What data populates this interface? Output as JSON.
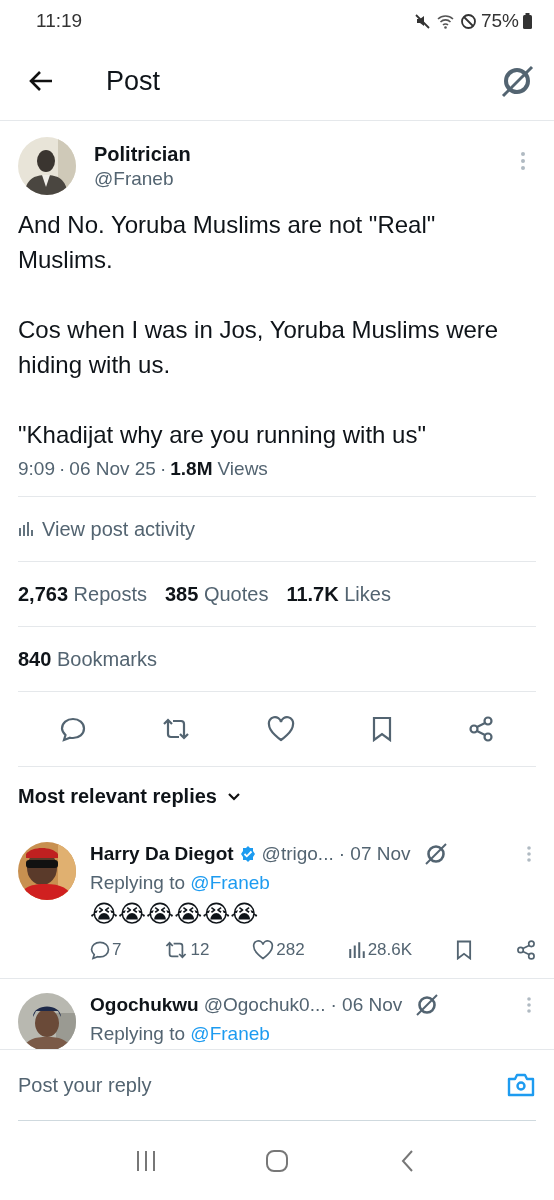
{
  "status_bar": {
    "time": "11:19",
    "battery": "75%"
  },
  "header": {
    "title": "Post"
  },
  "post": {
    "author": {
      "name": "Politrician",
      "handle": "@Franeb"
    },
    "paragraphs": [
      "And No. Yoruba Muslims are not \"Real\" Muslims.",
      "Cos when I was in Jos, Yoruba Muslims were hiding with us.",
      "\"Khadijat why are you running with us\""
    ],
    "time": "9:09",
    "separator": "·",
    "date": "06 Nov 25",
    "views_count": "1.8M",
    "views_label": "Views",
    "activity_link": "View post activity",
    "stats": [
      {
        "count": "2,763",
        "label": "Reposts"
      },
      {
        "count": "385",
        "label": "Quotes"
      },
      {
        "count": "11.7K",
        "label": "Likes"
      }
    ],
    "bookmarks": {
      "count": "840",
      "label": "Bookmarks"
    }
  },
  "replies_sort": "Most relevant replies",
  "replies": [
    {
      "name": "Harry Da Diegot",
      "verified": true,
      "handle": "@trigo...",
      "date": "· 07 Nov",
      "replying_label": "Replying to",
      "replying_to": "@Franeb",
      "text": "😭😭😭😭😭😭",
      "actions": {
        "replies": "7",
        "reposts": "12",
        "likes": "282",
        "views": "28.6K"
      }
    },
    {
      "name": "Ogochukwu",
      "verified": false,
      "handle": "@Ogochuk0...",
      "date": "· 06 Nov",
      "replying_label": "Replying to",
      "replying_to": "@Franeb"
    }
  ],
  "composer": {
    "placeholder": "Post your reply"
  }
}
